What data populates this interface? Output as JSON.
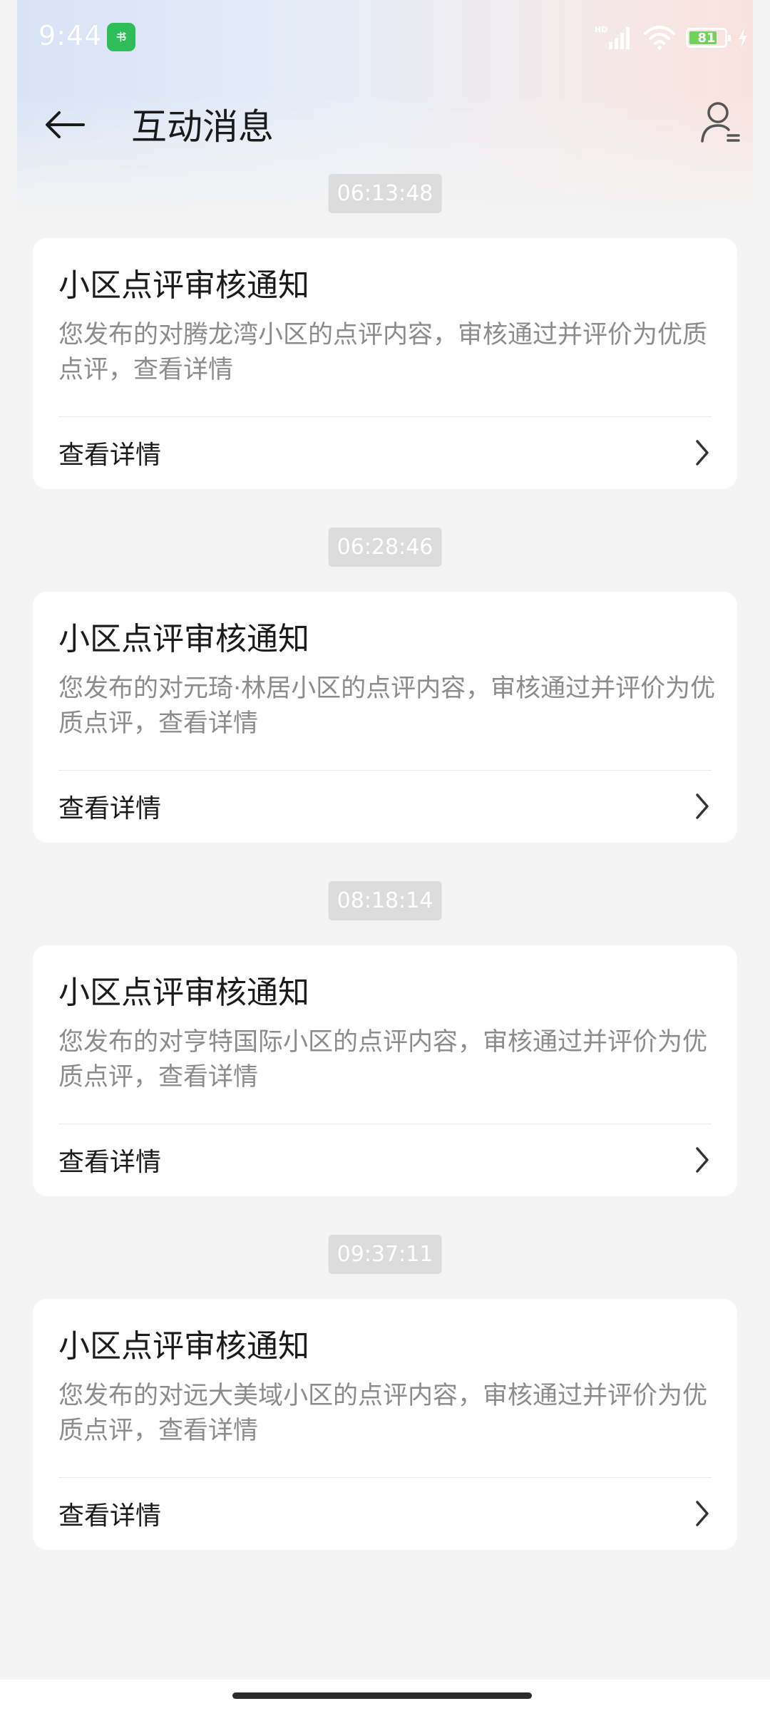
{
  "status_bar": {
    "time": "9:44",
    "app_badge": "书",
    "battery": "81",
    "battery_level": 0.81,
    "icons": [
      "hd-signal-icon",
      "wifi-icon",
      "battery-icon",
      "charging-icon"
    ]
  },
  "header": {
    "title": "互动消息",
    "back_icon": "arrow-left-icon",
    "profile_icon": "user-settings-icon"
  },
  "messages": [
    {
      "time": "06:13:48",
      "title": "小区点评审核通知",
      "body": "您发布的对腾龙湾小区的点评内容，审核通过并评价为优质点评，查看详情",
      "link": "查看详情"
    },
    {
      "time": "06:28:46",
      "title": "小区点评审核通知",
      "body": "您发布的对元琦·林居小区的点评内容，审核通过并评价为优质点评，查看详情",
      "link": "查看详情"
    },
    {
      "time": "08:18:14",
      "title": "小区点评审核通知",
      "body": "您发布的对亨特国际小区的点评内容，审核通过并评价为优质点评，查看详情",
      "link": "查看详情"
    },
    {
      "time": "09:37:11",
      "title": "小区点评审核通知",
      "body": "您发布的对远大美域小区的点评内容，审核通过并评价为优质点评，查看详情",
      "link": "查看详情"
    }
  ],
  "colors": {
    "page_bg": "#f4f4f4",
    "card_bg": "#ffffff",
    "timestamp_bg": "#dcdcdc",
    "body_text": "#8c8c8c",
    "title_text": "#1b1b1b"
  }
}
